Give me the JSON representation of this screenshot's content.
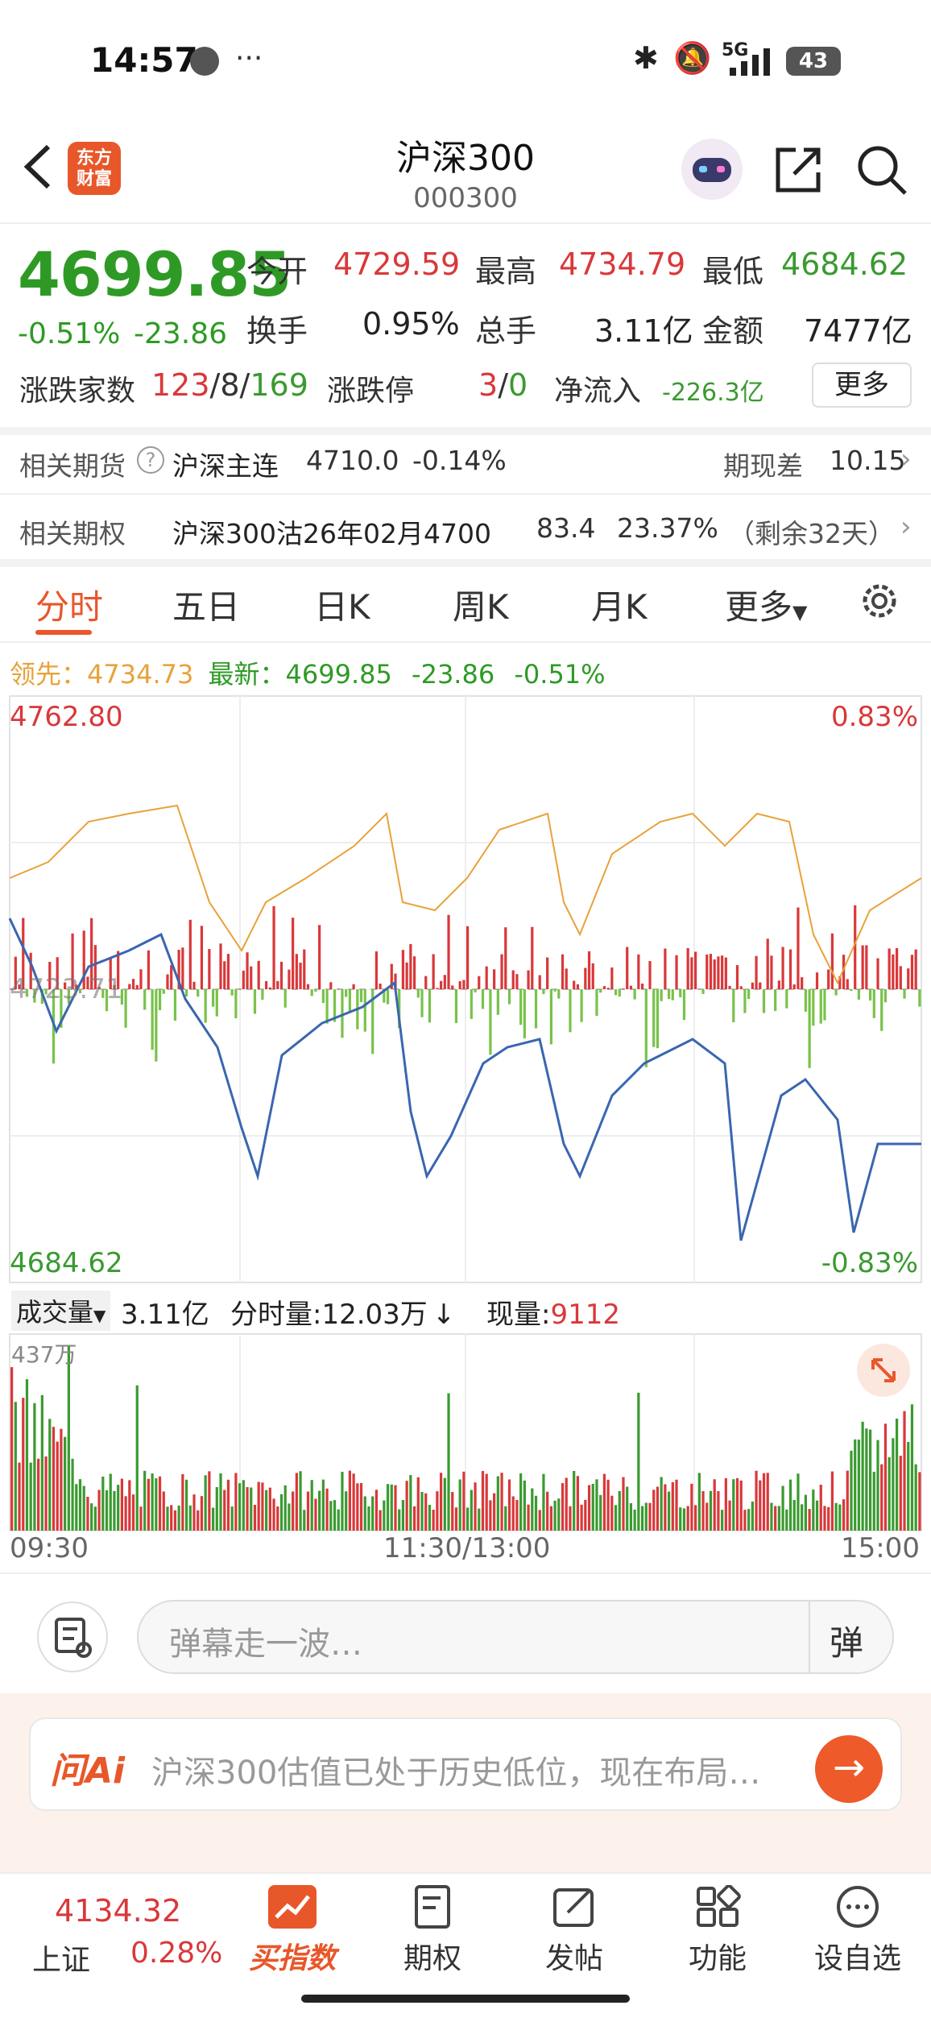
{
  "status": {
    "time": "14:57",
    "battery": "43",
    "network": "5G"
  },
  "header": {
    "title": "沪深300",
    "code": "000300",
    "logo_line1": "东方",
    "logo_line2": "财富"
  },
  "quote": {
    "price": "4699.85",
    "change_pct": "-0.51%",
    "change_val": "-23.86",
    "open_label": "今开",
    "open": "4729.59",
    "high_label": "最高",
    "high": "4734.79",
    "low_label": "最低",
    "low": "4684.62",
    "turnover_label": "换手",
    "turnover": "0.95%",
    "total_label": "总手",
    "total": "3.11亿",
    "amount_label": "金额",
    "amount": "7477亿",
    "breadth_label": "涨跌家数",
    "up": "123",
    "flat": "8",
    "down": "169",
    "limit_label": "涨跌停",
    "limit_up": "3",
    "limit_down": "0",
    "inflow_label": "净流入",
    "inflow": "-226.3亿",
    "more": "更多"
  },
  "futures": {
    "label": "相关期货",
    "name": "沪深主连",
    "price": "4710.0",
    "pct": "-0.14%",
    "basis_label": "期现差",
    "basis": "10.15"
  },
  "options": {
    "label": "相关期权",
    "name": "沪深300沽26年02月4700",
    "price": "83.4",
    "pct": "23.37%",
    "remain": "（剩余32天）"
  },
  "tabs": [
    "分时",
    "五日",
    "日K",
    "周K",
    "月K",
    "更多"
  ],
  "chart": {
    "lead_label": "领先：",
    "lead": "4734.73",
    "latest_label": "最新：",
    "latest": "4699.85",
    "latest_chg": "-23.86",
    "latest_pct": "-0.51%",
    "top_price": "4762.80",
    "top_pct": "0.83%",
    "bottom_price": "4684.62",
    "bottom_pct": "-0.83%",
    "mid_price": "4723.71"
  },
  "volume": {
    "label": "成交量",
    "total": "3.11亿",
    "per_min_label": "分时量:",
    "per_min": "12.03万",
    "arrow": "↓",
    "now_label": "现量:",
    "now": "9112",
    "max_label": "437万",
    "time_start": "09:30",
    "time_mid": "11:30/13:00",
    "time_end": "15:00"
  },
  "danmaku": {
    "placeholder": "弹幕走一波…",
    "send": "弹"
  },
  "ai": {
    "logo": "问Ai",
    "text": "沪深300估值已处于历史低位，现在布局…"
  },
  "nav": {
    "sh_price": "4134.32",
    "sh_label": "上证",
    "sh_pct": "0.28%",
    "items": [
      {
        "label": "买指数",
        "icon": "chart-up-icon"
      },
      {
        "label": "期权",
        "icon": "document-icon"
      },
      {
        "label": "发帖",
        "icon": "edit-icon"
      },
      {
        "label": "功能",
        "icon": "grid-icon"
      },
      {
        "label": "设自选",
        "icon": "more-icon"
      }
    ]
  },
  "colors": {
    "accent": "#e8572a",
    "up": "#d9383a",
    "down": "#2e9a25",
    "price_line": "#3a66b0",
    "avg_line": "#e8a23a"
  }
}
